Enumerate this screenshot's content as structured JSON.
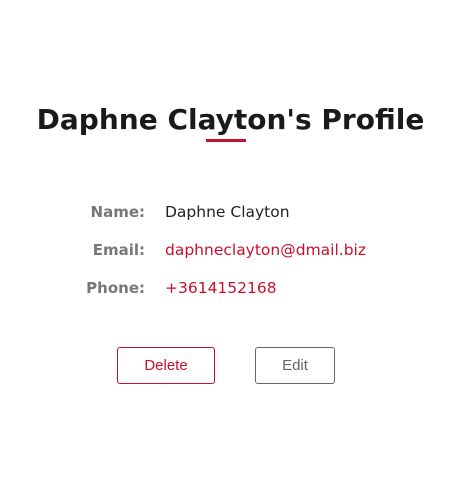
{
  "profile": {
    "title": "Daphne Clayton's Profile",
    "fields": {
      "name_label": "Name:",
      "name_value": "Daphne Clayton",
      "email_label": "Email:",
      "email_value": "daphneclayton@dmail.biz",
      "phone_label": "Phone:",
      "phone_value": "+3614152168"
    },
    "actions": {
      "delete_label": "Delete",
      "edit_label": "Edit"
    }
  },
  "colors": {
    "accent": "#c8102e",
    "label": "#777777",
    "text": "#222222",
    "edit_border": "#666666"
  }
}
